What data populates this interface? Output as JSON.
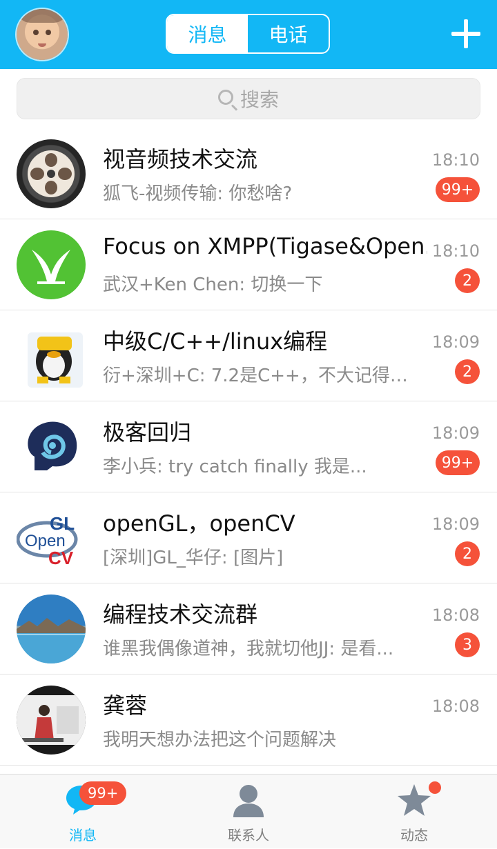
{
  "header": {
    "tabs": [
      {
        "label": "消息",
        "active": true
      },
      {
        "label": "电话",
        "active": false
      }
    ]
  },
  "search": {
    "placeholder": "搜索"
  },
  "conversations": [
    {
      "name": "视音频技术交流",
      "message": "狐飞-视频传输: 你愁啥?",
      "time": "18:10",
      "badge": "99+"
    },
    {
      "name": "Focus on XMPP(Tigase&Open.",
      "message": "武汉+Ken Chen: 切换一下",
      "time": "18:10",
      "badge": "2"
    },
    {
      "name": "中级C/C++/linux编程",
      "message": "衍+深圳+C: 7.2是C++，不大记得了...",
      "time": "18:09",
      "badge": "2"
    },
    {
      "name": "极客回归",
      "message": "李小兵: try  catch  finally     我是...",
      "time": "18:09",
      "badge": "99+"
    },
    {
      "name": "openGL，openCV",
      "message": "[深圳]GL_华仔: [图片]",
      "time": "18:09",
      "badge": "2"
    },
    {
      "name": "编程技术交流群",
      "message": "谁黑我偶像道神，我就切他JJ: 是看...",
      "time": "18:08",
      "badge": "3"
    },
    {
      "name": "龚蓉",
      "message": "我明天想办法把这个问题解决",
      "time": "18:08",
      "badge": ""
    }
  ],
  "bottom_nav": [
    {
      "label": "消息",
      "badge": "99+",
      "active": true
    },
    {
      "label": "联系人",
      "active": false
    },
    {
      "label": "动态",
      "active": false
    }
  ],
  "colors": {
    "accent": "#12b7f5",
    "badge": "#f5523a"
  }
}
